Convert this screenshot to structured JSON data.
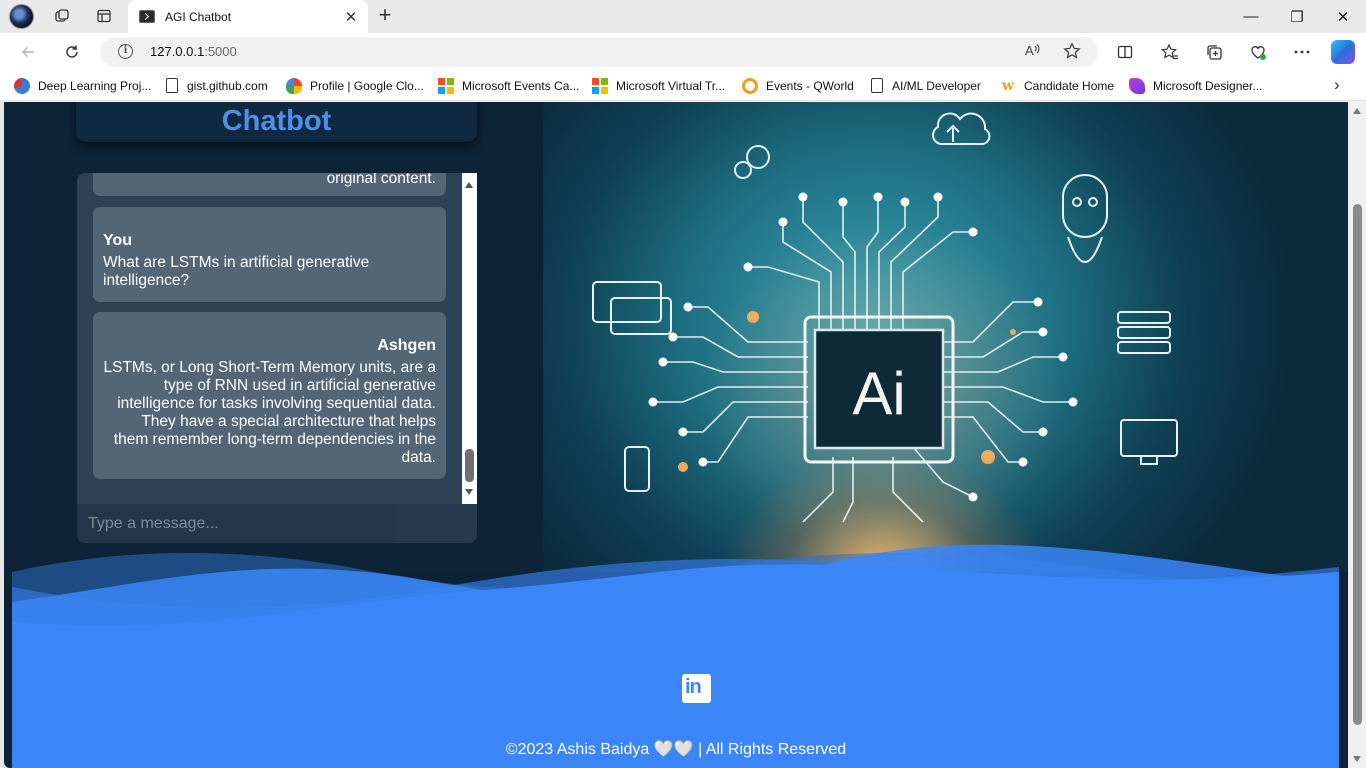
{
  "browser": {
    "tab_title": "AGI Chatbot",
    "tab_close": "✕",
    "new_tab": "+",
    "url_host": "127.0.0.1",
    "url_port": ":5000",
    "info_glyph": "i",
    "window_controls": {
      "minimize": "—",
      "restore": "❐",
      "close": "✕"
    },
    "bookmarks": [
      {
        "label": "Deep Learning Proj...",
        "icon": "deeplearning-icon"
      },
      {
        "label": "gist.github.com",
        "icon": "document-icon"
      },
      {
        "label": "Profile | Google Clo...",
        "icon": "google-cloud-icon"
      },
      {
        "label": "Microsoft Events Ca...",
        "icon": "microsoft-icon"
      },
      {
        "label": "Microsoft Virtual Tr...",
        "icon": "microsoft-icon"
      },
      {
        "label": "Events - QWorld",
        "icon": "qworld-icon"
      },
      {
        "label": "AI/ML Developer",
        "icon": "document-icon"
      },
      {
        "label": "Candidate Home",
        "icon": "workday-icon"
      },
      {
        "label": "Microsoft Designer...",
        "icon": "designer-icon"
      }
    ]
  },
  "chat": {
    "title": "Chatbot",
    "previous_message_tail": "original content.",
    "messages": [
      {
        "sender": "You",
        "text": "What are LSTMs in artificial generative intelligence?"
      },
      {
        "sender": "Ashgen",
        "text": "LSTMs, or Long Short-Term Memory units, are a type of RNN used in artificial generative intelligence for tasks involving sequential data. They have a special architecture that helps them remember long-term dependencies in the data."
      }
    ],
    "input_placeholder": "Type a message..."
  },
  "hero": {
    "chip_label": "Ai"
  },
  "footer": {
    "linkedin_label": "in",
    "copyright": "©2023 Ashis Baidya 🤍🤍 | All Rights Reserved"
  },
  "colors": {
    "page_bg": "#0c2337",
    "accent_blue": "#3a86f8",
    "title_blue": "#4f8fe6",
    "message_bubble": "#546576",
    "chat_bg": "#2e4255"
  }
}
